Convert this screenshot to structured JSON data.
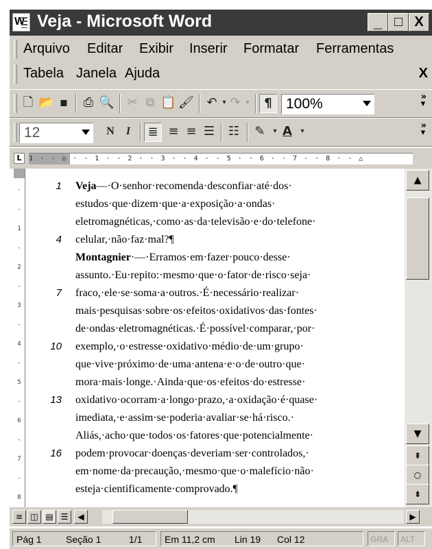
{
  "window": {
    "title": "Veja - Microsoft Word",
    "app_icon": "word-document-icon",
    "controls": {
      "minimize": "_",
      "maximize": "□",
      "close": "X"
    }
  },
  "menu": {
    "row1": [
      "Arquivo",
      "Editar",
      "Exibir",
      "Inserir",
      "Formatar",
      "Ferramentas"
    ],
    "row2": [
      "Tabela",
      "Janela",
      "Ajuda"
    ],
    "doc_close": "X"
  },
  "toolbar_standard": {
    "icons": [
      "new-document-icon",
      "open-folder-icon",
      "save-icon",
      "print-icon",
      "print-preview-icon",
      "cut-icon",
      "copy-icon",
      "paste-icon",
      "format-painter-icon",
      "undo-icon",
      "redo-icon",
      "show-paragraph-marks-icon"
    ],
    "zoom": "100%"
  },
  "toolbar_formatting": {
    "font_size": "12",
    "bold_label": "N",
    "italic_label": "I",
    "icons": [
      "align-left-icon",
      "align-center-icon",
      "align-right-icon",
      "justify-icon",
      "bullets-icon",
      "highlight-icon",
      "font-color-icon"
    ]
  },
  "ruler": {
    "marks": "1 · · ⌂ · · 1 · · 2 · · 3 · · 4 · · 5 · · 6 · · 7 · · 8 · · △"
  },
  "document": {
    "lines": [
      {
        "num": "1",
        "speaker": "Veja",
        "text": "—·O·senhor·recomenda·desconfiar·até·dos·"
      },
      {
        "num": "",
        "speaker": "",
        "text": "estudos·que·dizem·que·a·exposição·a·ondas·"
      },
      {
        "num": "",
        "speaker": "",
        "text": "eletromagnéticas,·como·as·da·televisão·e·do·telefone·"
      },
      {
        "num": "4",
        "speaker": "",
        "text": "celular,·não·faz·mal?¶"
      },
      {
        "num": "",
        "speaker": "Montagnier",
        "text": "·—·Erramos·em·fazer·pouco·desse·"
      },
      {
        "num": "",
        "speaker": "",
        "text": "assunto.·Eu·repito:·mesmo·que·o·fator·de·risco·seja·"
      },
      {
        "num": "7",
        "speaker": "",
        "text": "fraco,·ele·se·soma·a·outros.·É·necessário·realizar·"
      },
      {
        "num": "",
        "speaker": "",
        "text": "mais·pesquisas·sobre·os·efeitos·oxidativos·das·fontes·"
      },
      {
        "num": "",
        "speaker": "",
        "text": "de·ondas·eletromagnéticas.·É·possível·comparar,·por·"
      },
      {
        "num": "10",
        "speaker": "",
        "text": "exemplo,·o·estresse·oxidativo·médio·de·um·grupo·"
      },
      {
        "num": "",
        "speaker": "",
        "text": "que·vive·próximo·de·uma·antena·e·o·de·outro·que·"
      },
      {
        "num": "",
        "speaker": "",
        "text": "mora·mais·longe.·Ainda·que·os·efeitos·do·estresse·"
      },
      {
        "num": "13",
        "speaker": "",
        "text": "oxidativo·ocorram·a·longo·prazo,·a·oxidação·é·quase·"
      },
      {
        "num": "",
        "speaker": "",
        "text": "imediata,·e·assim·se·poderia·avaliar·se·há·risco.·"
      },
      {
        "num": "",
        "speaker": "",
        "text": "Aliás,·acho·que·todos·os·fatores·que·potencialmente·"
      },
      {
        "num": "16",
        "speaker": "",
        "text": "podem·provocar·doenças·deveriam·ser·controlados,·"
      },
      {
        "num": "",
        "speaker": "",
        "text": "em·nome·da·precaução,·mesmo·que·o·malefício·não·"
      },
      {
        "num": "",
        "speaker": "",
        "text": "esteja·cientificamente·comprovado.¶"
      }
    ]
  },
  "statusbar": {
    "page": "Pág 1",
    "section": "Seção 1",
    "pages": "1/1",
    "position": "Em 11,2 cm",
    "line": "Lin 19",
    "column": "Col 12",
    "rec": "GRA",
    "alt": "ALT"
  },
  "colors": {
    "titlebar": "#3a3a3a",
    "chrome": "#d4d0c8"
  }
}
